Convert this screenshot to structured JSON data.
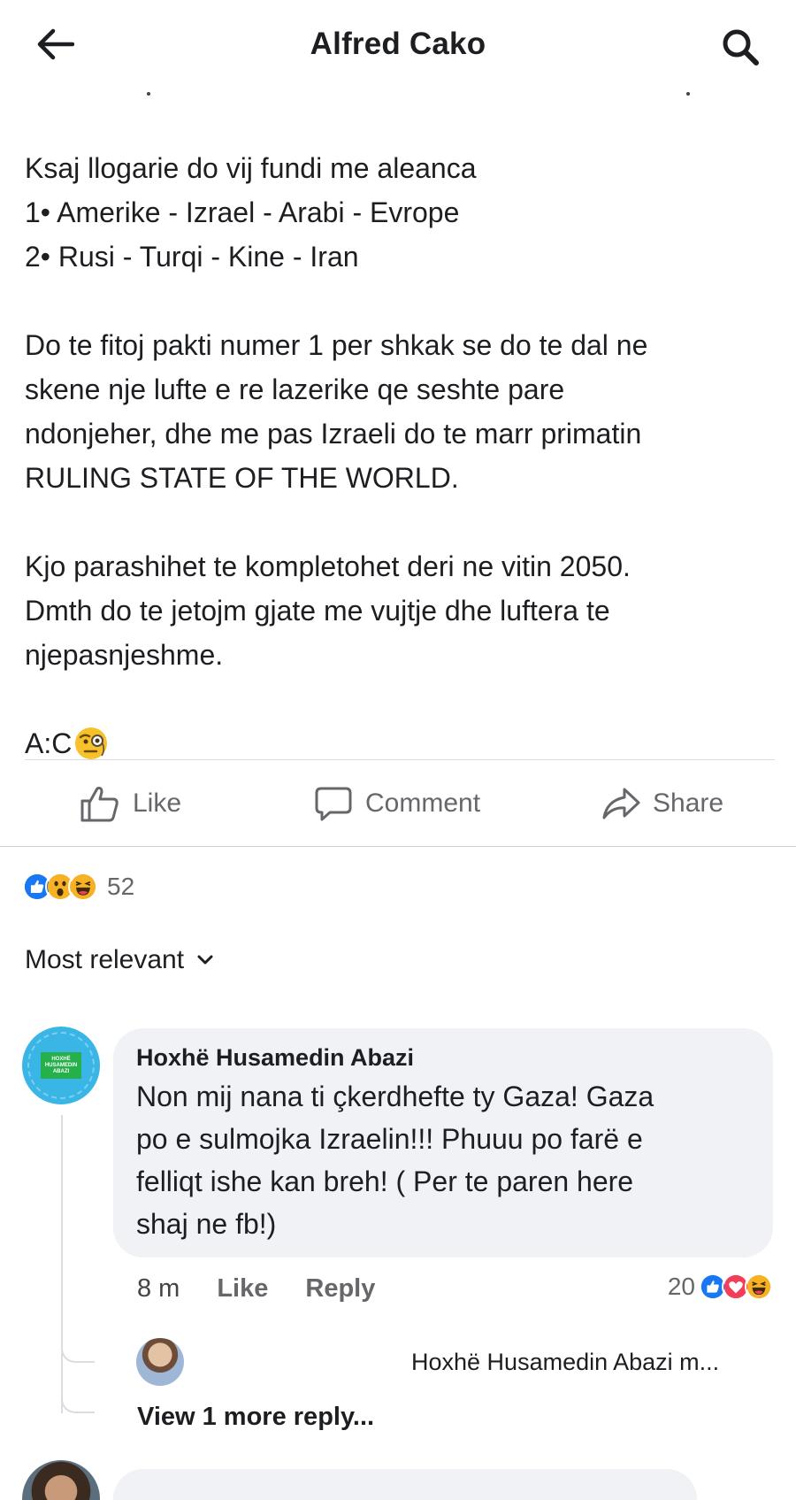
{
  "header": {
    "title": "Alfred Cako"
  },
  "post": {
    "lines_block1": [
      "Ksaj llogarie do vij fundi me aleanca",
      "1• Amerike - Izrael - Arabi - Evrope",
      "2• Rusi - Turqi - Kine - Iran"
    ],
    "lines_block2": [
      "Do te fitoj pakti numer 1 per shkak se do te dal ne",
      "skene nje lufte e re lazerike qe seshte pare",
      "ndonjeher, dhe me pas Izraeli do te marr primatin",
      "RULING STATE OF THE WORLD."
    ],
    "lines_block3": [
      "Kjo parashihet te kompletohet deri ne vitin 2050.",
      "Dmth do te jetojm gjate me vujtje dhe luftera te",
      "njepasnjeshme."
    ],
    "signature": "A:C",
    "signature_emoji": "face-with-monocle-emoji"
  },
  "actions": {
    "like": "Like",
    "comment": "Comment",
    "share": "Share"
  },
  "reactions": {
    "icons": [
      "like-icon",
      "wow-icon",
      "haha-icon"
    ],
    "count": "52"
  },
  "sort": {
    "label": "Most relevant"
  },
  "comment": {
    "author": "Hoxhë Husamedin Abazi",
    "avatar_badge": [
      "HOXHË",
      "HUSAMEDIN",
      "ABAZI"
    ],
    "text_lines": [
      "Non mij nana ti çkerdhefte ty Gaza! Gaza",
      "po e sulmojka Izraelin!!! Phuuu po farë e",
      "felliqt ishe kan breh! ( Per te paren here",
      "shaj ne fb!)"
    ],
    "time": "8 m",
    "like": "Like",
    "reply": "Reply",
    "reaction_count": "20",
    "reaction_icons": [
      "like-icon",
      "love-icon",
      "haha-icon"
    ]
  },
  "reply_preview": {
    "text": "Hoxhë Husamedin Abazi m..."
  },
  "more_replies": {
    "label": "View 1 more reply..."
  },
  "colors": {
    "like_blue": "#1877f2",
    "love_red": "#f33e58",
    "haha_yellow": "#f7b125",
    "bubble_bg": "#f0f2f5",
    "muted_text": "#65676b"
  }
}
